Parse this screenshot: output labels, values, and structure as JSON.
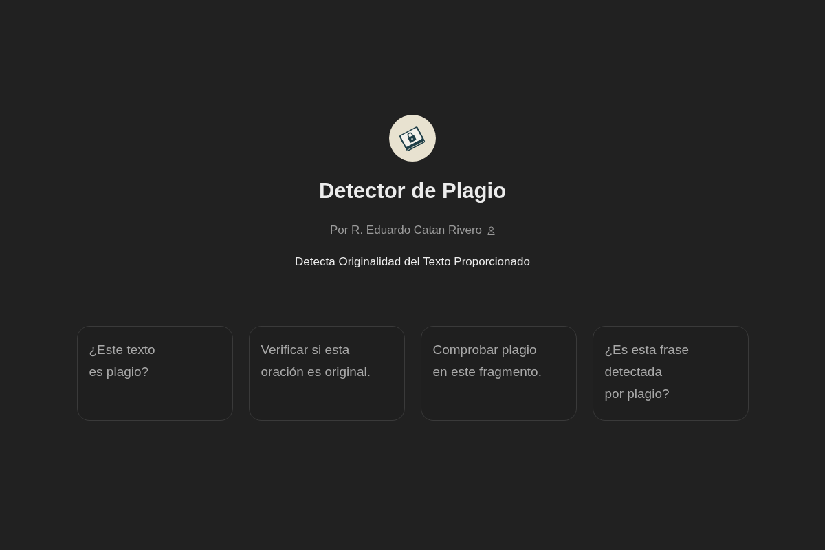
{
  "header": {
    "title": "Detector de Plagio",
    "author": "Por R. Eduardo Catan Rivero",
    "description": "Detecta Originalidad del Texto Proporcionado"
  },
  "prompts": [
    {
      "lines": [
        "¿Este texto",
        "es plagio?"
      ]
    },
    {
      "lines": [
        "Verificar si esta",
        "oración es original."
      ]
    },
    {
      "lines": [
        "Comprobar plagio",
        "en este fragmento."
      ]
    },
    {
      "lines": [
        "¿Es esta frase",
        "detectada",
        "por plagio?"
      ]
    }
  ]
}
